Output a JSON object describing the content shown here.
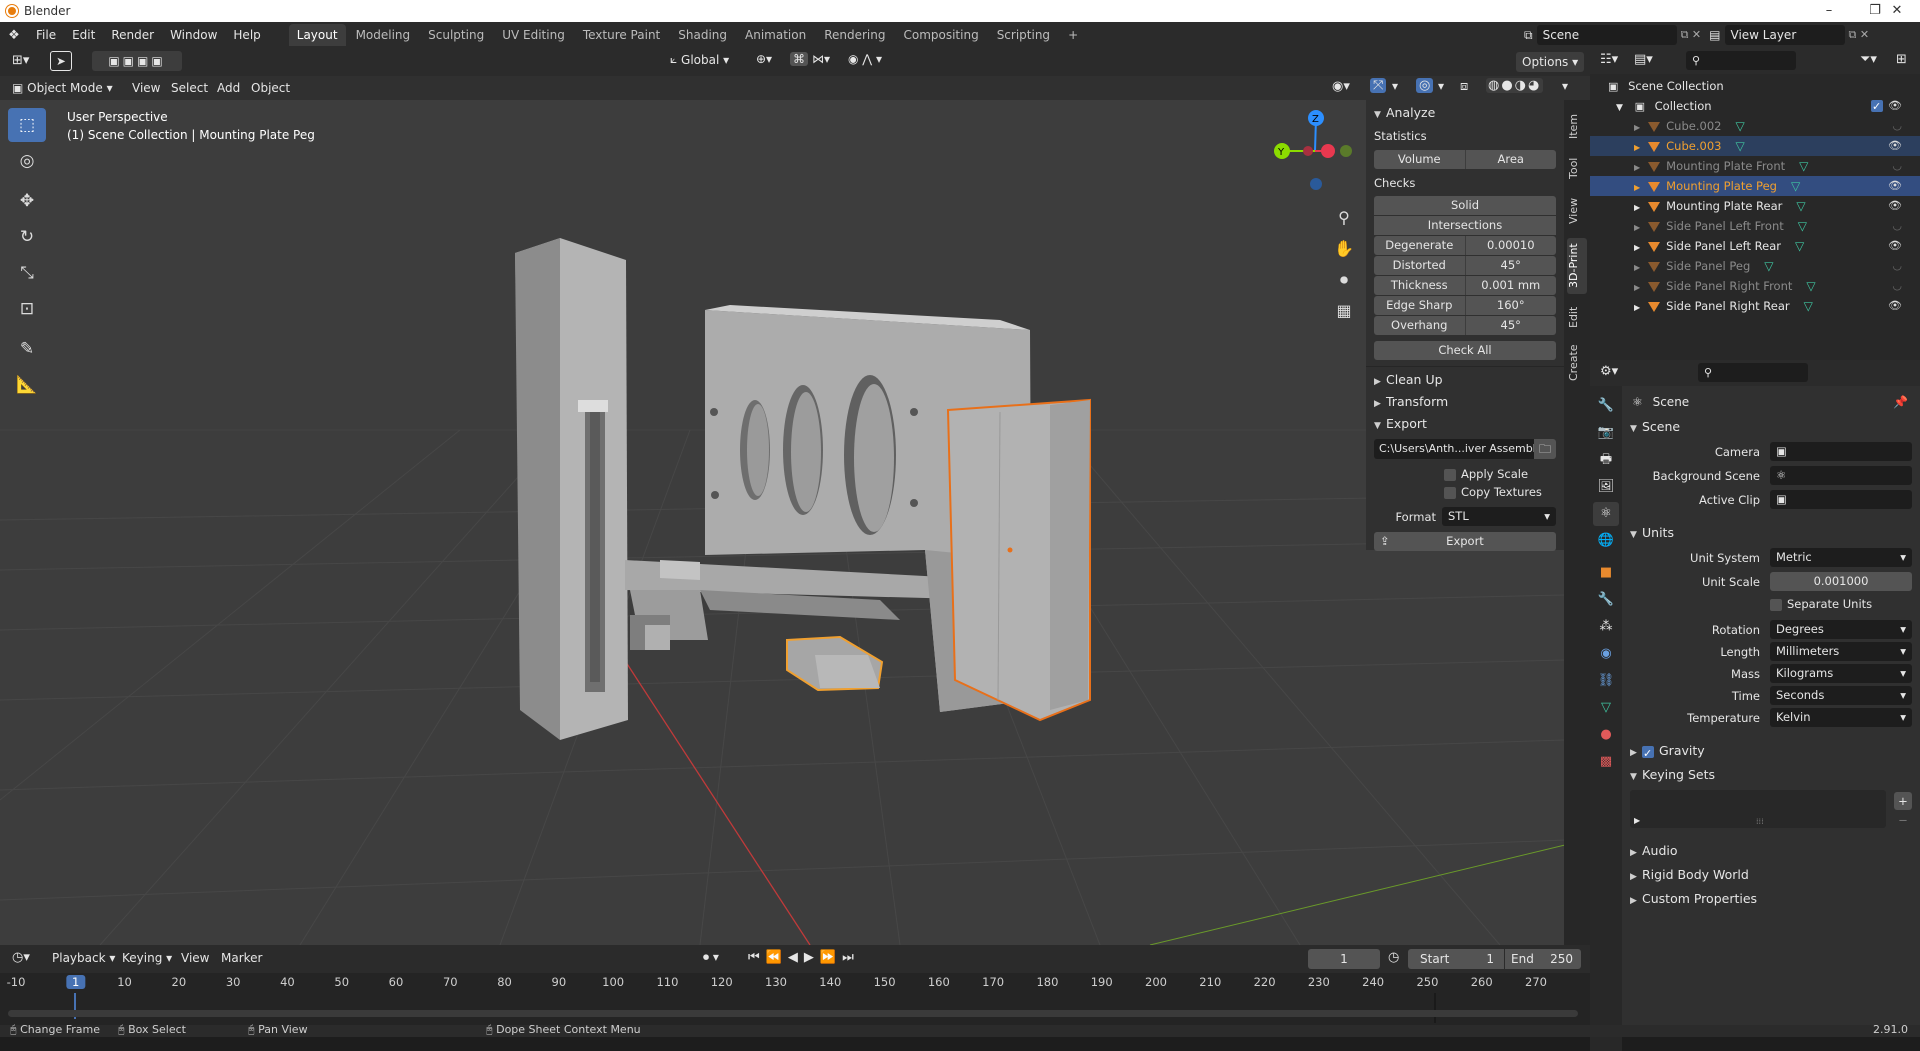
{
  "window": {
    "title": "Blender"
  },
  "menus": [
    "File",
    "Edit",
    "Render",
    "Window",
    "Help"
  ],
  "workspaces": [
    "Layout",
    "Modeling",
    "Sculpting",
    "UV Editing",
    "Texture Paint",
    "Shading",
    "Animation",
    "Rendering",
    "Compositing",
    "Scripting"
  ],
  "active_workspace": "Layout",
  "scene_field": "Scene",
  "view_layer_field": "View Layer",
  "viewport": {
    "transform_orientation": "Global",
    "options_label": "Options",
    "mode": "Object Mode",
    "menus": [
      "View",
      "Select",
      "Add",
      "Object"
    ],
    "overlay_title": "User Perspective",
    "overlay_subtitle": "(1) Scene Collection | Mounting Plate Peg",
    "gizmo_axes": {
      "z": "Z",
      "y": "Y"
    }
  },
  "npanel": {
    "tabs": [
      "Item",
      "Tool",
      "View",
      "3D-Print",
      "Edit",
      "Create"
    ],
    "active_tab": "3D-Print",
    "analyze_title": "Analyze",
    "statistics_label": "Statistics",
    "stat_buttons": [
      "Volume",
      "Area"
    ],
    "checks_label": "Checks",
    "check_buttons": [
      "Solid",
      "Intersections"
    ],
    "check_rows": [
      {
        "label": "Degenerate",
        "value": "0.00010"
      },
      {
        "label": "Distorted",
        "value": "45°"
      },
      {
        "label": "Thickness",
        "value": "0.001 mm"
      },
      {
        "label": "Edge Sharp",
        "value": "160°"
      },
      {
        "label": "Overhang",
        "value": "45°"
      }
    ],
    "check_all": "Check All",
    "cleanup": "Clean Up",
    "transform": "Transform",
    "export_title": "Export",
    "export_path": "C:\\Users\\Anth...iver Assembly\\",
    "apply_scale": "Apply Scale",
    "copy_textures": "Copy Textures",
    "format_label": "Format",
    "format_value": "STL",
    "export_button": "Export"
  },
  "outliner": {
    "root": "Scene Collection",
    "collection": "Collection",
    "items": [
      {
        "name": "Cube.002",
        "state": "dim"
      },
      {
        "name": "Cube.003",
        "state": "selo"
      },
      {
        "name": "Mounting Plate Front",
        "state": "dim"
      },
      {
        "name": "Mounting Plate Peg",
        "state": "active"
      },
      {
        "name": "Mounting Plate Rear",
        "state": "normal"
      },
      {
        "name": "Side Panel Left Front",
        "state": "dim"
      },
      {
        "name": "Side Panel Left Rear",
        "state": "normal"
      },
      {
        "name": "Side Panel Peg",
        "state": "dim"
      },
      {
        "name": "Side Panel Right Front",
        "state": "dim"
      },
      {
        "name": "Side Panel Right Rear",
        "state": "normal"
      }
    ]
  },
  "properties": {
    "context": "Scene",
    "scene_section": "Scene",
    "camera_label": "Camera",
    "background_scene_label": "Background Scene",
    "active_clip_label": "Active Clip",
    "units_section": "Units",
    "unit_system_label": "Unit System",
    "unit_system": "Metric",
    "unit_scale_label": "Unit Scale",
    "unit_scale": "0.001000",
    "separate_units": "Separate Units",
    "rotation_label": "Rotation",
    "rotation": "Degrees",
    "length_label": "Length",
    "length": "Millimeters",
    "mass_label": "Mass",
    "mass": "Kilograms",
    "time_label": "Time",
    "time": "Seconds",
    "temperature_label": "Temperature",
    "temperature": "Kelvin",
    "gravity": "Gravity",
    "keying_sets": "Keying Sets",
    "audio": "Audio",
    "rigid_body_world": "Rigid Body World",
    "custom_properties": "Custom Properties"
  },
  "timeline": {
    "menus": [
      "Playback",
      "Keying",
      "View",
      "Marker"
    ],
    "current_frame": "1",
    "start_label": "Start",
    "start": "1",
    "end_label": "End",
    "end": "250",
    "ticks": [
      "-10",
      "1",
      "10",
      "20",
      "30",
      "40",
      "50",
      "60",
      "70",
      "80",
      "90",
      "100",
      "110",
      "120",
      "130",
      "140",
      "150",
      "160",
      "170",
      "180",
      "190",
      "200",
      "210",
      "220",
      "230",
      "240",
      "250",
      "260",
      "270"
    ]
  },
  "statusbar": {
    "items": [
      "Change Frame",
      "Box Select",
      "Pan View",
      "Dope Sheet Context Menu"
    ],
    "version": "2.91.0"
  },
  "colors": {
    "accent": "#4772b3",
    "selection_orange": "#f0a030",
    "mesh_icon": "#3fc4a0",
    "axis_x": "#e8384f",
    "axis_y": "#8bdc00",
    "axis_z": "#2c8fff"
  }
}
